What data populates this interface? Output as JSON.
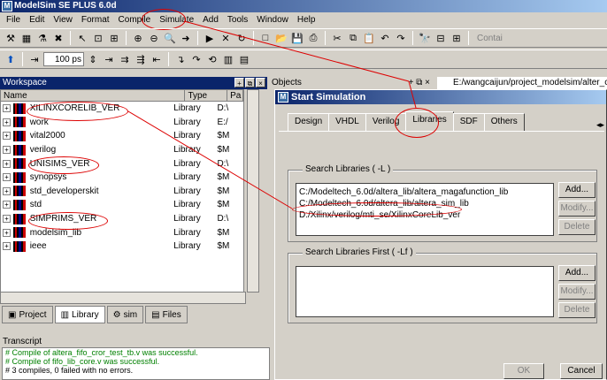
{
  "window": {
    "title": "ModelSim SE PLUS 6.0d"
  },
  "menu": [
    "File",
    "Edit",
    "View",
    "Format",
    "Compile",
    "Simulate",
    "Add",
    "Tools",
    "Window",
    "Help"
  ],
  "toolbar": {
    "zoom_value": "100 ps",
    "contain_label": "Contai"
  },
  "workspace": {
    "title": "Workspace",
    "columns": [
      "Name",
      "Type",
      "Pa"
    ],
    "rows": [
      {
        "name": "XILINXCORELIB_VER",
        "type": "Library",
        "path": "D:\\"
      },
      {
        "name": "work",
        "type": "Library",
        "path": "E:/"
      },
      {
        "name": "vital2000",
        "type": "Library",
        "path": "$M"
      },
      {
        "name": "verilog",
        "type": "Library",
        "path": "$M"
      },
      {
        "name": "UNISIMS_VER",
        "type": "Library",
        "path": "D:\\"
      },
      {
        "name": "synopsys",
        "type": "Library",
        "path": "$M"
      },
      {
        "name": "std_developerskit",
        "type": "Library",
        "path": "$M"
      },
      {
        "name": "std",
        "type": "Library",
        "path": "$M"
      },
      {
        "name": "SIMPRIMS_VER",
        "type": "Library",
        "path": "D:\\"
      },
      {
        "name": "modelsim_lib",
        "type": "Library",
        "path": "$M"
      },
      {
        "name": "ieee",
        "type": "Library",
        "path": "$M"
      }
    ],
    "tabs": [
      "Project",
      "Library",
      "sim",
      "Files"
    ]
  },
  "transcript": {
    "title": "Transcript",
    "lines": [
      "# Compile of altera_fifo_cror_test_tb.v was successful.",
      "# Compile of fifo_lib_core.v was successful.",
      "# 3 compiles, 0 failed with no errors."
    ]
  },
  "objects": {
    "title": "Objects",
    "path": "E:/wangcaijun/project_modelsim/alter_c"
  },
  "dialog": {
    "title": "Start Simulation",
    "tabs": [
      "Design",
      "VHDL",
      "Verilog",
      "Libraries",
      "SDF",
      "Others"
    ],
    "search_libs_label": "Search Libraries ( -L )",
    "search_libs": [
      "C:/Modeltech_6.0d/altera_lib/altera_magafunction_lib",
      "C:/Modeltech_6.0d/altera_lib/altera_sim_lib",
      "D:/Xilinx/verilog/mti_se/XilinxCoreLib_ver"
    ],
    "search_first_label": "Search Libraries First ( -Lf )",
    "buttons": {
      "add": "Add...",
      "modify": "Modify...",
      "delete": "Delete",
      "ok": "OK",
      "cancel": "Cancel"
    }
  }
}
